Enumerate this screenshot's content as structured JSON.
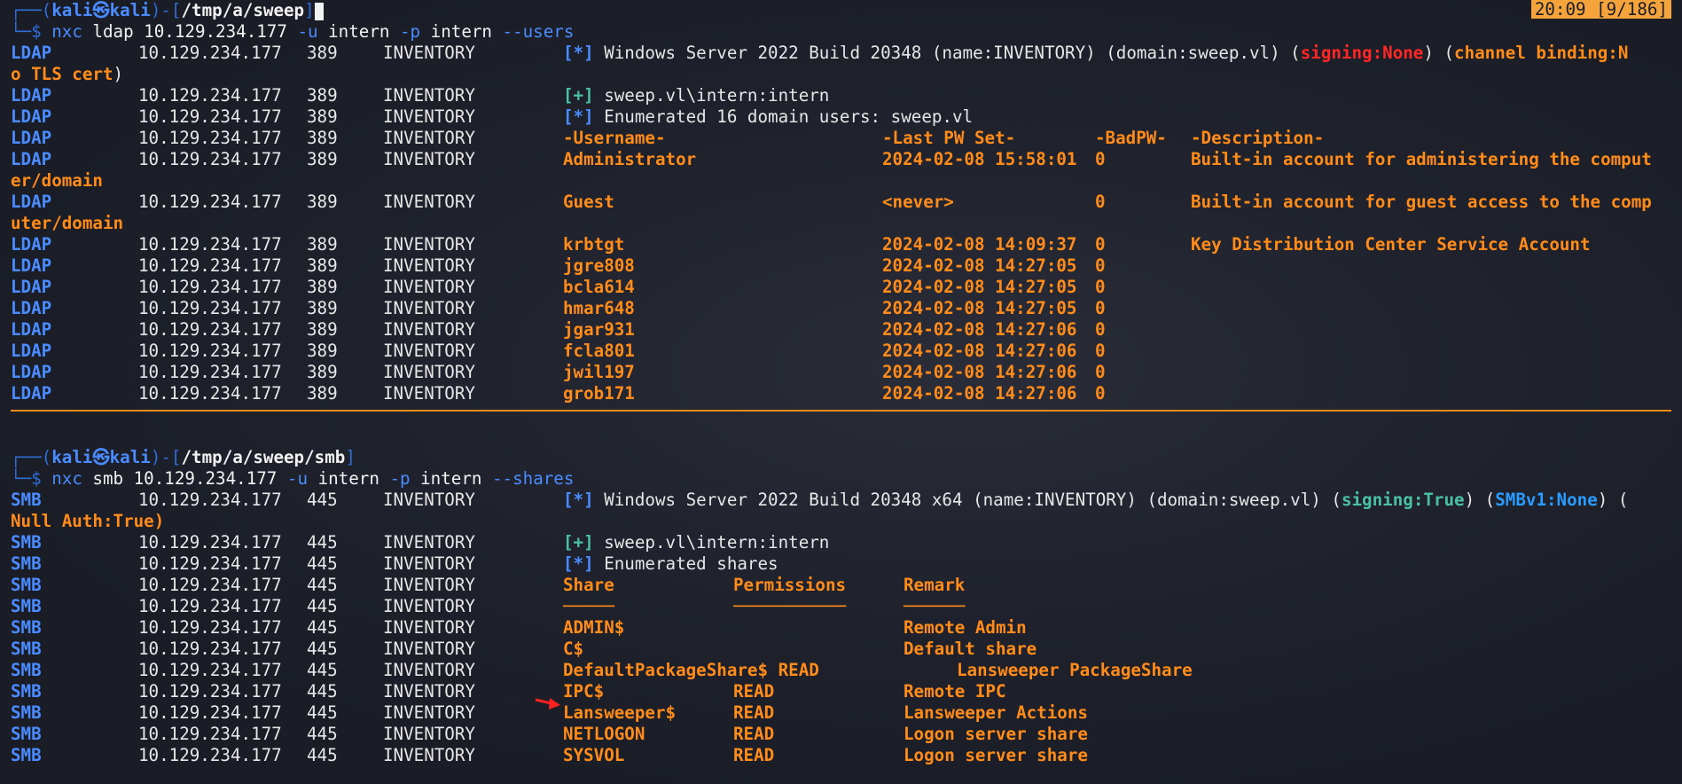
{
  "status": {
    "clock": "20:09 [9/186]"
  },
  "block1": {
    "prompt": {
      "top": "┌──(",
      "user": "kali㉿kali",
      "mid": ")-[",
      "path": "/tmp/a/sweep",
      "end": "]",
      "bottom": "└─$ "
    },
    "command": {
      "tool": "nxc",
      "rest1": " ldap 10.129.234.177 ",
      "flag1": "-u",
      "val1": " intern ",
      "flag2": "-p",
      "val2": " intern ",
      "flag3": "--users"
    },
    "info": {
      "proto": "LDAP",
      "ip": "10.129.234.177",
      "port": "389",
      "host": "INVENTORY",
      "tag": "[*]",
      "text": " Windows Server 2022 Build 20348 (name:INVENTORY) (domain:sweep.vl) (",
      "signing": "signing:None",
      "mid": ") (",
      "channel": "channel binding:N",
      "cont_a": "o TLS cert",
      "cont_b": ")"
    },
    "auth": {
      "tag": "[+]",
      "text": " sweep.vl\\intern:intern"
    },
    "enum": {
      "tag": "[*]",
      "text": " Enumerated 16 domain users: sweep.vl"
    },
    "headers": {
      "user": "-Username-",
      "pw": "-Last PW Set-",
      "bad": "-BadPW-",
      "desc": "-Description-"
    },
    "users": [
      {
        "name": "Administrator",
        "pwset": "2024-02-08 15:58:01",
        "bad": "0",
        "desc": "Built-in account for administering the comput",
        "desc2": "er/domain"
      },
      {
        "name": "Guest",
        "pwset": "<never>",
        "bad": "0",
        "desc": "Built-in account for guest access to the comp",
        "desc2": "uter/domain"
      },
      {
        "name": "krbtgt",
        "pwset": "2024-02-08 14:09:37",
        "bad": "0",
        "desc": "Key Distribution Center Service Account"
      },
      {
        "name": "jgre808",
        "pwset": "2024-02-08 14:27:05",
        "bad": "0"
      },
      {
        "name": "bcla614",
        "pwset": "2024-02-08 14:27:05",
        "bad": "0"
      },
      {
        "name": "hmar648",
        "pwset": "2024-02-08 14:27:05",
        "bad": "0"
      },
      {
        "name": "jgar931",
        "pwset": "2024-02-08 14:27:06",
        "bad": "0"
      },
      {
        "name": "fcla801",
        "pwset": "2024-02-08 14:27:06",
        "bad": "0"
      },
      {
        "name": "jwil197",
        "pwset": "2024-02-08 14:27:06",
        "bad": "0"
      },
      {
        "name": "grob171",
        "pwset": "2024-02-08 14:27:06",
        "bad": "0"
      }
    ]
  },
  "block2": {
    "prompt": {
      "top": "┌──(",
      "user": "kali㉿kali",
      "mid": ")-[",
      "path": "/tmp/a/sweep/smb",
      "end": "]",
      "bottom": "└─$ "
    },
    "command": {
      "tool": "nxc",
      "rest1": " smb 10.129.234.177 ",
      "flag1": "-u",
      "val1": " intern ",
      "flag2": "-p",
      "val2": " intern ",
      "flag3": "--shares"
    },
    "info": {
      "proto": "SMB",
      "ip": "10.129.234.177",
      "port": "445",
      "host": "INVENTORY",
      "tag": "[*]",
      "text": " Windows Server 2022 Build 20348 x64 (name:INVENTORY) (domain:sweep.vl) (",
      "signing": "signing:True",
      "mid": ") (",
      "smbv1": "SMBv1:None",
      "tail": ") (",
      "cont": "Null Auth:True)"
    },
    "auth": {
      "tag": "[+]",
      "text": " sweep.vl\\intern:intern"
    },
    "enum": {
      "tag": "[*]",
      "text": " Enumerated shares"
    },
    "headers": {
      "share": "Share",
      "perm": "Permissions",
      "remark": "Remark",
      "share_ul": "─────",
      "perm_ul": "───────────",
      "remark_ul": "──────"
    },
    "shares": [
      {
        "name": "ADMIN$",
        "perm": "",
        "remark": "Remote Admin"
      },
      {
        "name": "C$",
        "perm": "",
        "remark": "Default share"
      },
      {
        "name": "DefaultPackageShare$",
        "perm": " READ",
        "remark": "Lansweeper PackageShare"
      },
      {
        "name": "IPC$",
        "perm": "READ",
        "remark": "Remote IPC"
      },
      {
        "name": "Lansweeper$",
        "perm": "READ",
        "remark": "Lansweeper Actions"
      },
      {
        "name": "NETLOGON",
        "perm": "READ",
        "remark": "Logon server share"
      },
      {
        "name": "SYSVOL",
        "perm": "READ",
        "remark": "Logon server share"
      }
    ]
  },
  "colors": {
    "accent": "#ff8c1a",
    "blue": "#4a8cff",
    "green": "#4ac2a2",
    "red": "#ff2626",
    "bg": "#1b1e28"
  }
}
